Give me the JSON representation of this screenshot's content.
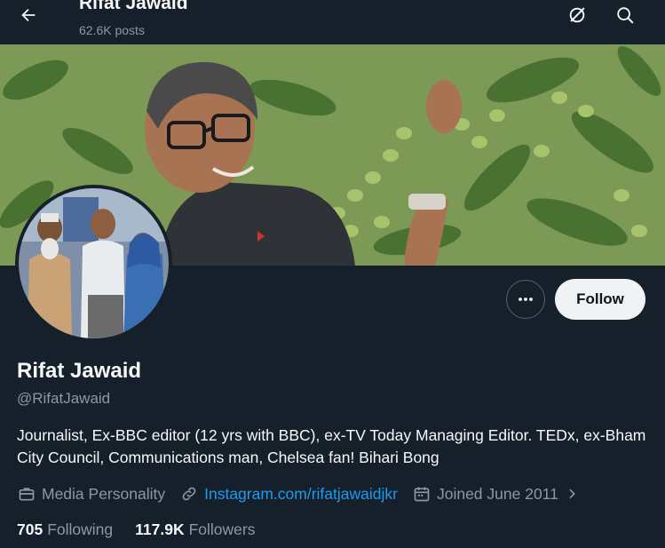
{
  "header": {
    "name": "Rifat Jawaid",
    "posts_count": "62.6K posts",
    "back_icon": "arrow-left-icon",
    "grok_icon": "grok-icon",
    "search_icon": "search-icon"
  },
  "profile": {
    "display_name": "Rifat Jawaid",
    "handle": "@RifatJawaid",
    "bio": "Journalist, Ex-BBC editor (12 yrs with BBC), ex-TV Today Managing Editor. TEDx, ex-Bham City Council, Communications man, Chelsea fan! Bihari Bong",
    "category": "Media Personality",
    "website": "Instagram.com/rifatjawaidjkr",
    "joined": "Joined June 2011",
    "following_count": "705",
    "following_label": "Following",
    "followers_count": "117.9K",
    "followers_label": "Followers"
  },
  "actions": {
    "follow_label": "Follow",
    "more_icon": "more-icon"
  },
  "colors": {
    "background": "#15202b",
    "link": "#1d9bf0",
    "secondary_text": "#8b98a5",
    "follow_button": "#eff3f4"
  }
}
